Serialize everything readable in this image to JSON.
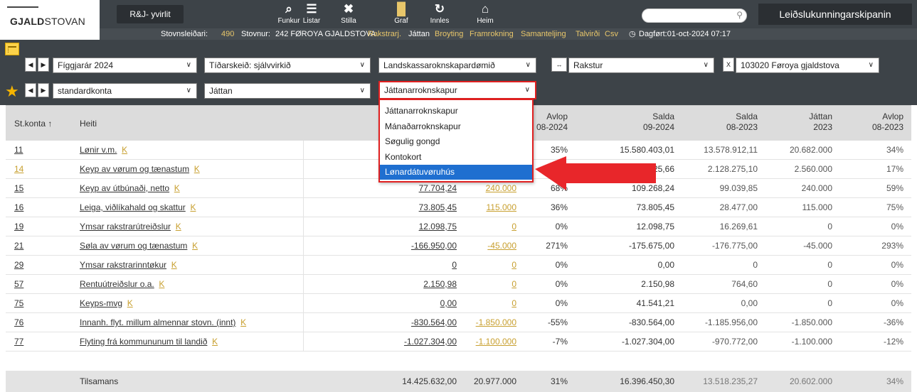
{
  "header": {
    "logo_bold": "GJALD",
    "logo_rest": "STOVAN",
    "rj_button": "R&J- yvirlit",
    "nav": [
      {
        "label": "Funkur",
        "icon": "search-icon"
      },
      {
        "label": "Listar",
        "icon": "list-icon"
      },
      {
        "label": "Stilla",
        "icon": "tools-icon"
      },
      {
        "label": "Graf",
        "icon": "chart-icon"
      },
      {
        "label": "Innles",
        "icon": "refresh-icon"
      },
      {
        "label": "Heim",
        "icon": "home-icon"
      }
    ],
    "search_placeholder": "",
    "leid_button": "Leiðslukunningarskipanin"
  },
  "status": {
    "stovnsleidari_label": "Stovnsleiðari:",
    "stovnsleidari_value": "490",
    "stovnur_label": "Stovnur:",
    "stovnur_value": "242 FØROYA GJALDSTOVA",
    "links": [
      "Rakstrarj.",
      "Játtan",
      "Broyting",
      "Framrokning",
      "Samanteljing",
      "Talvirði",
      "Csv"
    ],
    "dagfort": "Dagført:01-oct-2024 07:17"
  },
  "filters": {
    "year": "Fíggjarár 2024",
    "period": "Tíðarskeið: sjálvvirkið",
    "report": "Landskassaroknskapardømið",
    "type": "Rakstur",
    "org": "103020 Føroya gjaldstova",
    "konta": "standardkonta",
    "jattan": "Játtan",
    "view": "Játtanarroknskapur",
    "x_label": "X",
    "swap_label": "↔"
  },
  "dropdown": {
    "options": [
      "Játtanarroknskapur",
      "Mánaðarroknskapur",
      "Søgulig gongd",
      "Kontokort",
      "Lønardátuvøruhús"
    ],
    "active_index": 4
  },
  "table": {
    "headers": {
      "stkonta": "St.konta",
      "heiti": "Heiti",
      "avlop_a1": "Avlop",
      "avlop_a2": "08-2024",
      "salda_a1": "Salda",
      "salda_a2": "09-2024",
      "salda_b1": "Salda",
      "salda_b2": "08-2023",
      "jattan_b1": "Játtan",
      "jattan_b2": "2023",
      "avlop_b1": "Avlop",
      "avlop_b2": "08-2023"
    },
    "rows": [
      {
        "no": "11",
        "name": "Lønir v.m.",
        "k": "K",
        "c1": "",
        "c2": "",
        "avlop": "35%",
        "salda": "15.580.403,01",
        "salda23": "13.578.912,11",
        "jattan23": "20.682.000",
        "avlop23": "34%"
      },
      {
        "no": "14",
        "name": "Keyp av vørum og tænastum",
        "k": "K",
        "c1": "",
        "c2": "",
        "avlop": "",
        "salda": "0.725,66",
        "salda23": "2.128.275,10",
        "jattan23": "2.560.000",
        "avlop23": "17%"
      },
      {
        "no": "15",
        "name": "Keyp av útbúnaði, netto",
        "k": "K",
        "c1": "77.704,24",
        "c2": "240.000",
        "avlop": "68%",
        "salda": "109.268,24",
        "salda23": "99.039,85",
        "jattan23": "240.000",
        "avlop23": "59%"
      },
      {
        "no": "16",
        "name": "Leiga, viðlíkahald og skattur",
        "k": "K",
        "c1": "73.805,45",
        "c2": "115.000",
        "avlop": "36%",
        "salda": "73.805,45",
        "salda23": "28.477,00",
        "jattan23": "115.000",
        "avlop23": "75%"
      },
      {
        "no": "19",
        "name": "Ymsar rakstrarútreiðslur",
        "k": "K",
        "c1": "12.098,75",
        "c2": "0",
        "avlop": "0%",
        "salda": "12.098,75",
        "salda23": "16.269,61",
        "jattan23": "0",
        "avlop23": "0%"
      },
      {
        "no": "21",
        "name": "Søla av vørum og tænastum",
        "k": "K",
        "c1": "-166.950,00",
        "c2": "-45.000",
        "avlop": "271%",
        "salda": "-175.675,00",
        "salda23": "-176.775,00",
        "jattan23": "-45.000",
        "avlop23": "293%"
      },
      {
        "no": "29",
        "name": "Ymsar rakstrarinntøkur",
        "k": "K",
        "c1": "0",
        "c2": "0",
        "avlop": "0%",
        "salda": "0,00",
        "salda23": "0",
        "jattan23": "0",
        "avlop23": "0%"
      },
      {
        "no": "57",
        "name": "Rentuútreiðslur o.a.",
        "k": "K",
        "c1": "2.150,98",
        "c2": "0",
        "avlop": "0%",
        "salda": "2.150,98",
        "salda23": "764,60",
        "jattan23": "0",
        "avlop23": "0%"
      },
      {
        "no": "75",
        "name": "Keyps-mvg",
        "k": "K",
        "c1": "0,00",
        "c2": "0",
        "avlop": "0%",
        "salda": "41.541,21",
        "salda23": "0,00",
        "jattan23": "0",
        "avlop23": "0%"
      },
      {
        "no": "76",
        "name": "Innanh. flyt. millum almennar stovn. (innt)",
        "k": "K",
        "c1": "-830.564,00",
        "c2": "-1.850.000",
        "avlop": "-55%",
        "salda": "-830.564,00",
        "salda23": "-1.185.956,00",
        "jattan23": "-1.850.000",
        "avlop23": "-36%"
      },
      {
        "no": "77",
        "name": "Flyting frá kommununum til landið",
        "k": "K",
        "c1": "-1.027.304,00",
        "c2": "-1.100.000",
        "avlop": "-7%",
        "salda": "-1.027.304,00",
        "salda23": "-970.772,00",
        "jattan23": "-1.100.000",
        "avlop23": "-12%"
      }
    ],
    "total": {
      "label": "Tilsamans",
      "c1": "14.425.632,00",
      "c2": "20.977.000",
      "avlop": "31%",
      "salda": "16.396.450,30",
      "salda23": "13.518.235,27",
      "jattan23": "20.602.000",
      "avlop23": "34%"
    }
  },
  "colors": {
    "nav_dark": "#3d4348",
    "accent_gold": "#e8c66a",
    "highlight_red": "#e02020",
    "selected_blue": "#1f6fd0"
  }
}
